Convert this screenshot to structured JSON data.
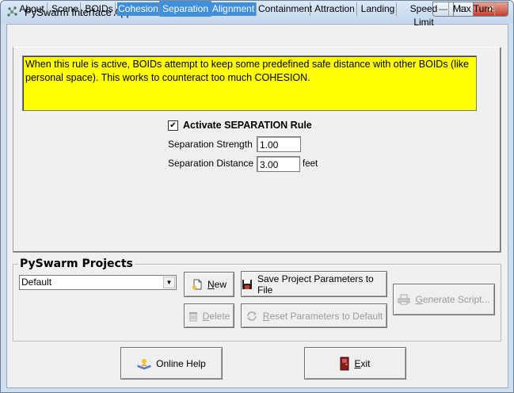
{
  "window": {
    "title": "PySwarm Interface Application",
    "min_glyph": "—",
    "max_glyph": "□",
    "close_glyph": "✕"
  },
  "tabs": [
    {
      "label": "About"
    },
    {
      "label": "Scene"
    },
    {
      "label": "BOIDs"
    },
    {
      "label": "Cohesion"
    },
    {
      "label": "Separation"
    },
    {
      "label": "Alignment"
    },
    {
      "label": "Containment"
    },
    {
      "label": "Attraction"
    },
    {
      "label": "Landing"
    },
    {
      "label": "Speed Limit"
    },
    {
      "label": "Max Turn"
    }
  ],
  "separation": {
    "description": "When this rule is active, BOIDs attempt to keep some predefined safe distance with other BOIDs (like personal space). This works to counteract too much COHESION.",
    "activate_label": "Activate SEPARATION Rule",
    "activate_checked": "✔",
    "strength_label": "Separation Strength",
    "strength_value": "1.00",
    "distance_label": "Separation Distance",
    "distance_value": "3.00",
    "distance_unit": "feet"
  },
  "projects": {
    "group_title": "PySwarm Projects",
    "selected": "Default",
    "dropdown_glyph": "▼",
    "new_label_u": "N",
    "new_label_rest": "ew",
    "delete_label_u": "D",
    "delete_label_rest": "elete",
    "save_label": "Save Project Parameters to File",
    "reset_label_u": "R",
    "reset_label_rest": "eset Parameters to Default",
    "generate_label_u": "G",
    "generate_label_rest": "enerate Script..."
  },
  "footer": {
    "help_label": "Online Help",
    "exit_label_u": "E",
    "exit_label_rest": "xit"
  },
  "colors": {
    "description_bg": "#ffff00",
    "tab_highlight": "#3f8fdc"
  }
}
